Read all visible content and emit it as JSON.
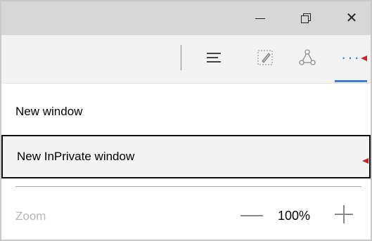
{
  "titlebar": {
    "minimize_icon": "minimize-icon",
    "restore_icon": "restore-icon",
    "close_glyph": "✕"
  },
  "toolbar": {
    "icons": [
      "hub-icon",
      "web-note-icon",
      "share-icon",
      "more-actions-icon"
    ],
    "more_dots": "···",
    "accent_color": "#3a7fd5"
  },
  "menu": {
    "new_window": "New window",
    "new_inprivate_window": "New InPrivate window",
    "zoom_label": "Zoom",
    "zoom_value": "100%"
  },
  "annotations": {
    "arrow_color": "#d62020"
  }
}
